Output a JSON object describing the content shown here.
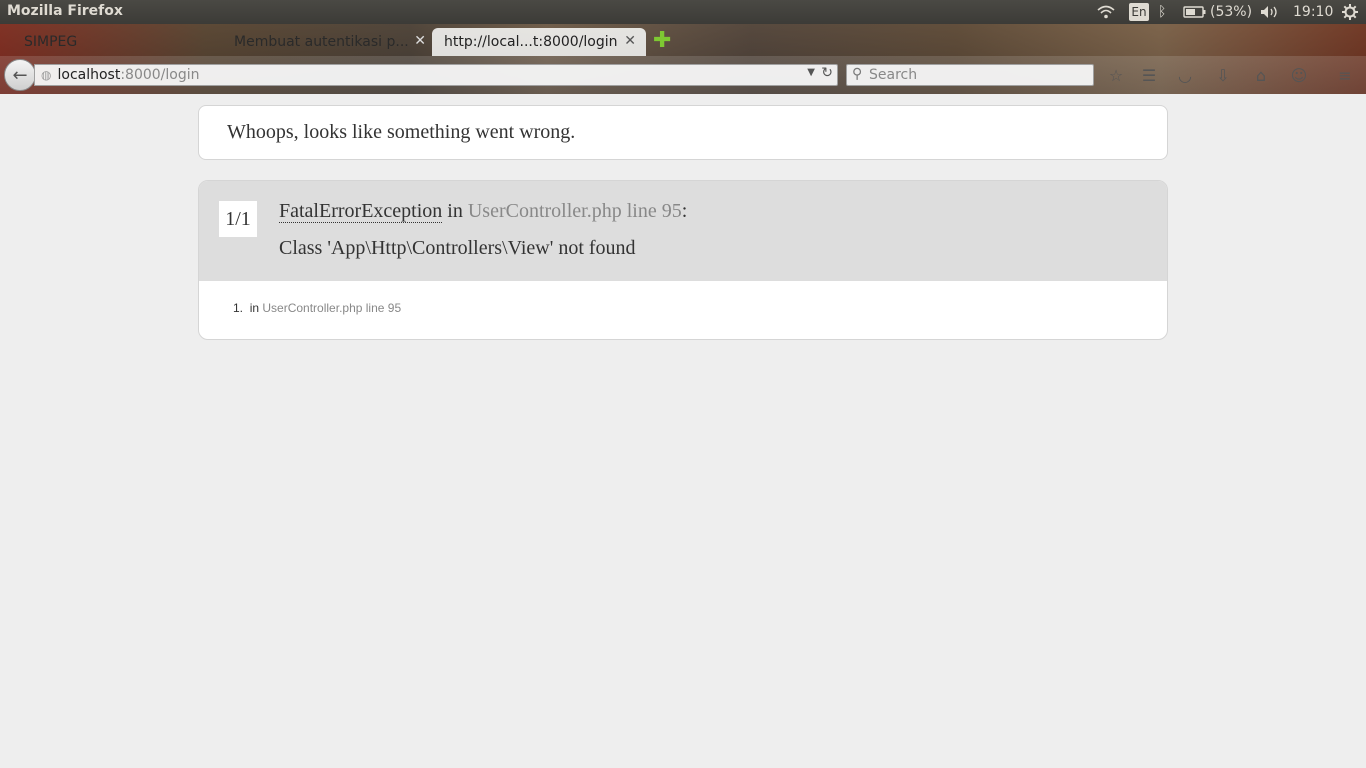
{
  "panel": {
    "app_title": "Mozilla Firefox",
    "lang": "En",
    "battery": "(53%)",
    "clock": "19:10"
  },
  "tabs": [
    {
      "label": "SIMPEG"
    },
    {
      "label": "Membuat autentikasi p..."
    },
    {
      "label": "http://local...t:8000/login"
    }
  ],
  "navbar": {
    "url_host": "localhost",
    "url_rest": ":8000/login",
    "search_placeholder": "Search"
  },
  "page": {
    "whoops": "Whoops, looks like something went wrong.",
    "counter": "1/1",
    "exception_class": "FatalErrorException",
    "in_word": "in",
    "location": "UserController.php line 95",
    "colon": ":",
    "message": "Class 'App\\Http\\Controllers\\View' not found",
    "trace": [
      {
        "num": "1.",
        "in_word": "in",
        "location": "UserController.php line 95"
      }
    ]
  },
  "colors": {
    "panel_bg": "#3c3b37",
    "page_bg": "#eeeeee",
    "exception_header": "#dddddd",
    "muted_text": "#888888",
    "new_tab_plus": "#7ec832"
  }
}
